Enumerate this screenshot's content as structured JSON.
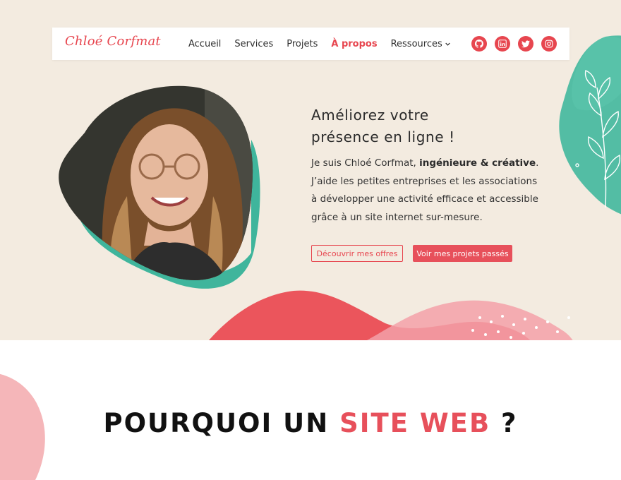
{
  "brand": {
    "name": "Chloé Corfmat"
  },
  "nav": {
    "items": [
      {
        "label": "Accueil"
      },
      {
        "label": "Services"
      },
      {
        "label": "Projets"
      },
      {
        "label": "À propos",
        "active": true
      },
      {
        "label": "Ressources"
      }
    ]
  },
  "socials": [
    {
      "icon": "github-icon"
    },
    {
      "icon": "linkedin-icon"
    },
    {
      "icon": "twitter-icon"
    },
    {
      "icon": "instagram-icon"
    }
  ],
  "hero": {
    "title_line1": "Améliorez votre",
    "title_line2": "présence en ligne !",
    "intro_prefix": "Je suis Chloé Corfmat, ",
    "intro_bold": "ingénieure & créative",
    "intro_suffix": ".",
    "line2": "J’aide les petites entreprises et les associations",
    "line3": "à développer une activité efficace et accessible",
    "line4": "grâce à un site internet sur-mesure.",
    "button_offers": "Découvrir mes offres",
    "button_projects": "Voir mes projets passés"
  },
  "section": {
    "title_start": "POURQUOI UN ",
    "title_accent": "SITE WEB",
    "title_end": " ?"
  },
  "colors": {
    "accent": "#e7464f",
    "hero_bg": "#f3ebe0",
    "teal": "#3fb59c",
    "pink": "#f4a7ab"
  }
}
